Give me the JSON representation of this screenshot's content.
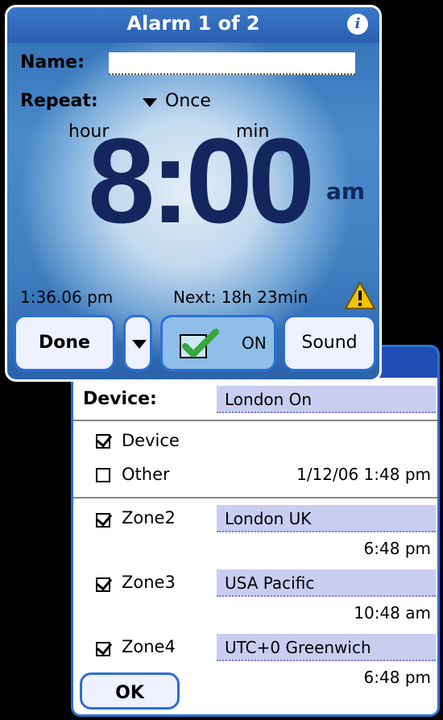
{
  "alarm": {
    "title": "Alarm 1 of 2",
    "name_label": "Name:",
    "name_value": "",
    "repeat_label": "Repeat:",
    "repeat_value": "Once",
    "hour_label": "hour",
    "min_label": "min",
    "time": "8:00",
    "ampm": "am",
    "current_time": "1:36.06 pm",
    "next_alarm": "Next: 18h 23min",
    "buttons": {
      "done": "Done",
      "on": "ON",
      "sound": "Sound"
    }
  },
  "zones": {
    "device_label": "Device:",
    "device_value": "London On",
    "source_options": [
      {
        "label": "Device",
        "checked": true
      },
      {
        "label": "Other",
        "checked": false
      }
    ],
    "datetime": "1/12/06 1:48 pm",
    "rows": [
      {
        "label": "Zone2",
        "zone": "London UK",
        "time": "6:48 pm",
        "checked": true
      },
      {
        "label": "Zone3",
        "zone": "USA Pacific",
        "time": "10:48 am",
        "checked": true
      },
      {
        "label": "Zone4",
        "zone": "UTC+0 Greenwich",
        "time": "6:48 pm",
        "checked": true
      }
    ],
    "ok": "OK"
  },
  "colors": {
    "accent": "#2b6fd8",
    "field_bg": "#c9cdf0",
    "time_text": "#13275e"
  },
  "icons": [
    "info-icon",
    "warning-icon",
    "check-icon",
    "dropdown-arrow-icon"
  ]
}
